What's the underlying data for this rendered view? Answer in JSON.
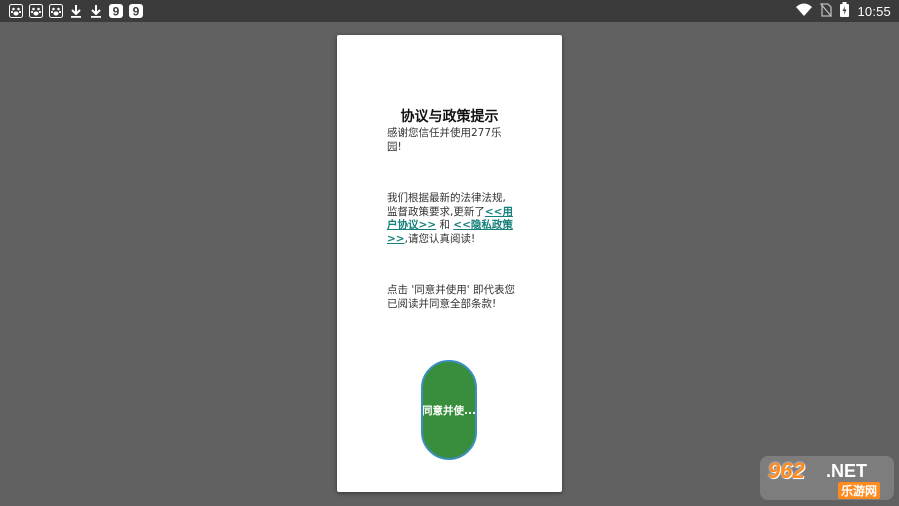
{
  "status_bar": {
    "time": "10:55",
    "left_icons": [
      "baidu-icon",
      "baidu-icon",
      "baidu-icon",
      "download-icon",
      "download-icon",
      "nine-app-icon",
      "nine-app-icon"
    ],
    "right_icons": [
      "wifi-icon",
      "no-sim-icon",
      "battery-charging-icon"
    ]
  },
  "dialog": {
    "title": "协议与政策提示",
    "para1": "感谢您信任并使用277乐园!",
    "para2_before": "我们根据最新的法律法规,监督政策要求,更新了",
    "user_agreement_link": "<<用户协议>>",
    "para2_and": " 和 ",
    "privacy_policy_link": "<<隐私政策>>",
    "para2_after": ",请您认真阅读!",
    "para3": "点击 '同意并使用' 即代表您已阅读并同意全部条款!",
    "agree_button_label": "同意并使..."
  },
  "watermark": {
    "number": "962",
    "suffix": ".NET",
    "subtitle": "乐游网"
  },
  "colors": {
    "background": "#616161",
    "status_bar": "#3b3b3b",
    "link": "#15807a",
    "button": "#388e3c",
    "button_border": "#3b8fbf",
    "watermark_orange": "#ff8a1e"
  }
}
